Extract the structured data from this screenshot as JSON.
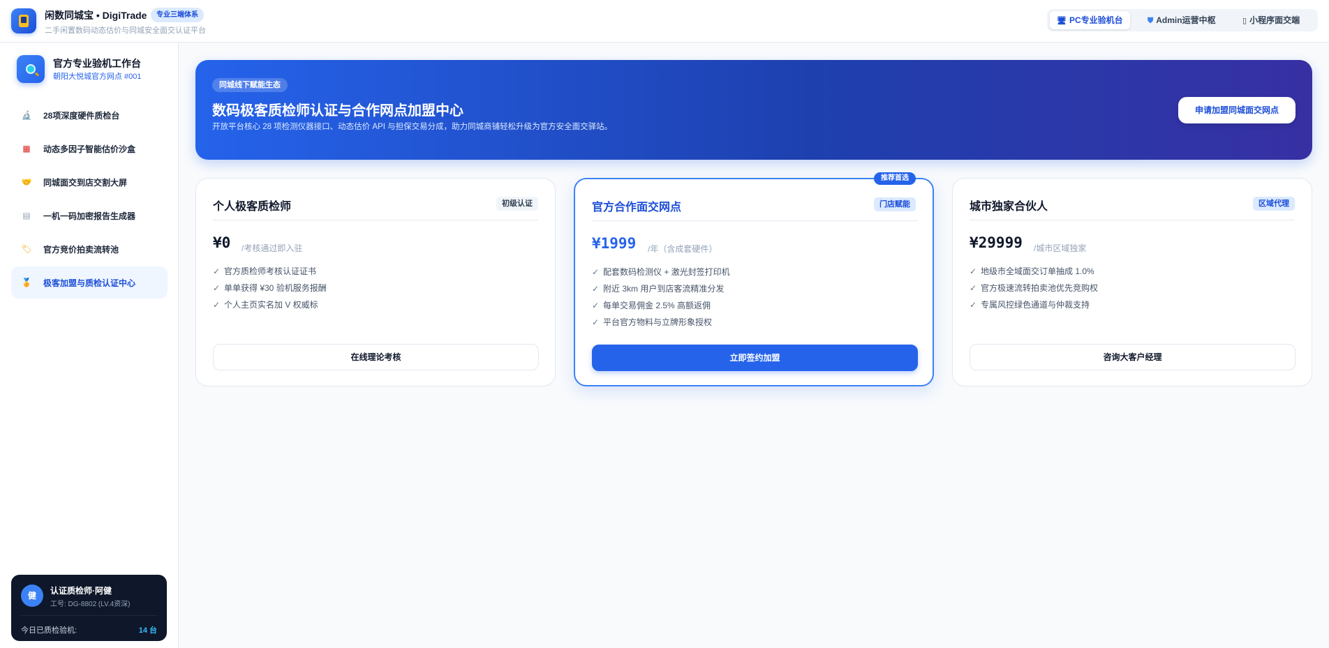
{
  "header": {
    "app_title": "闲数同城宝 • DigiTrade",
    "tag": "专业三端体系",
    "subtitle": "二手闲置数码动态估价与同城安全面交认证平台",
    "nav": [
      {
        "label": "PC专业验机台",
        "icon": "monitor-icon",
        "active": true
      },
      {
        "label": "Admin运营中枢",
        "icon": "shield-icon",
        "active": false
      },
      {
        "label": "小程序面交端",
        "icon": "phone-icon",
        "active": false
      }
    ]
  },
  "sidebar": {
    "workspace_title": "官方专业验机工作台",
    "workspace_sub": "朝阳大悦城官方网点 #001",
    "items": [
      {
        "label": "28项深度硬件质检台",
        "icon": "microscope-icon"
      },
      {
        "label": "动态多因子智能估价沙盒",
        "icon": "abacus-icon"
      },
      {
        "label": "同城面交到店交割大屏",
        "icon": "handshake-icon"
      },
      {
        "label": "一机一码加密报告生成器",
        "icon": "document-icon"
      },
      {
        "label": "官方竞价拍卖流转池",
        "icon": "tag-icon"
      },
      {
        "label": "极客加盟与质检认证中心",
        "icon": "medal-icon",
        "active": true
      }
    ],
    "user": {
      "avatar": "健",
      "name": "认证质检师·阿健",
      "id": "工号: DG-8802 (LV.4资深)",
      "count_label": "今日已质检验机:",
      "count_value": "14 台"
    }
  },
  "banner": {
    "tag": "同城线下赋能生态",
    "title": "数码极客质检师认证与合作网点加盟中心",
    "desc": "开放平台核心 28 项检测仪器接口、动态估价 API 与担保交易分成，助力同城商铺轻松升级为官方安全面交驿站。",
    "button": "申请加盟同城面交网点"
  },
  "plans": [
    {
      "title": "个人极客质检师",
      "badge": "初级认证",
      "price": "¥0",
      "unit": "/考核通过即入驻",
      "features": [
        "官方质检师考核认证证书",
        "单单获得 ¥30 验机服务报酬",
        "个人主页实名加 V 权威标"
      ],
      "button": "在线理论考核"
    },
    {
      "title": "官方合作面交网点",
      "badge": "门店赋能",
      "recommend": "推荐首选",
      "price": "¥1999",
      "unit": "/年（含成套硬件）",
      "features": [
        "配套数码检测仪 + 激光封签打印机",
        "附近 3km 用户到店客流精准分发",
        "每单交易佣金 2.5% 高额返佣",
        "平台官方物料与立牌形象授权"
      ],
      "button": "立即签约加盟"
    },
    {
      "title": "城市独家合伙人",
      "badge": "区域代理",
      "price": "¥29999",
      "unit": "/城市区域独家",
      "features": [
        "地级市全域面交订单抽成 1.0%",
        "官方极速流转拍卖池优先竞购权",
        "专属风控绿色通道与仲裁支持"
      ],
      "button": "咨询大客户经理"
    }
  ],
  "check_glyph": "✓",
  "colors": {
    "accent": "#2563eb",
    "banner_start": "#2563eb",
    "banner_end": "#3730a3",
    "dark_card": "#0f172a"
  }
}
